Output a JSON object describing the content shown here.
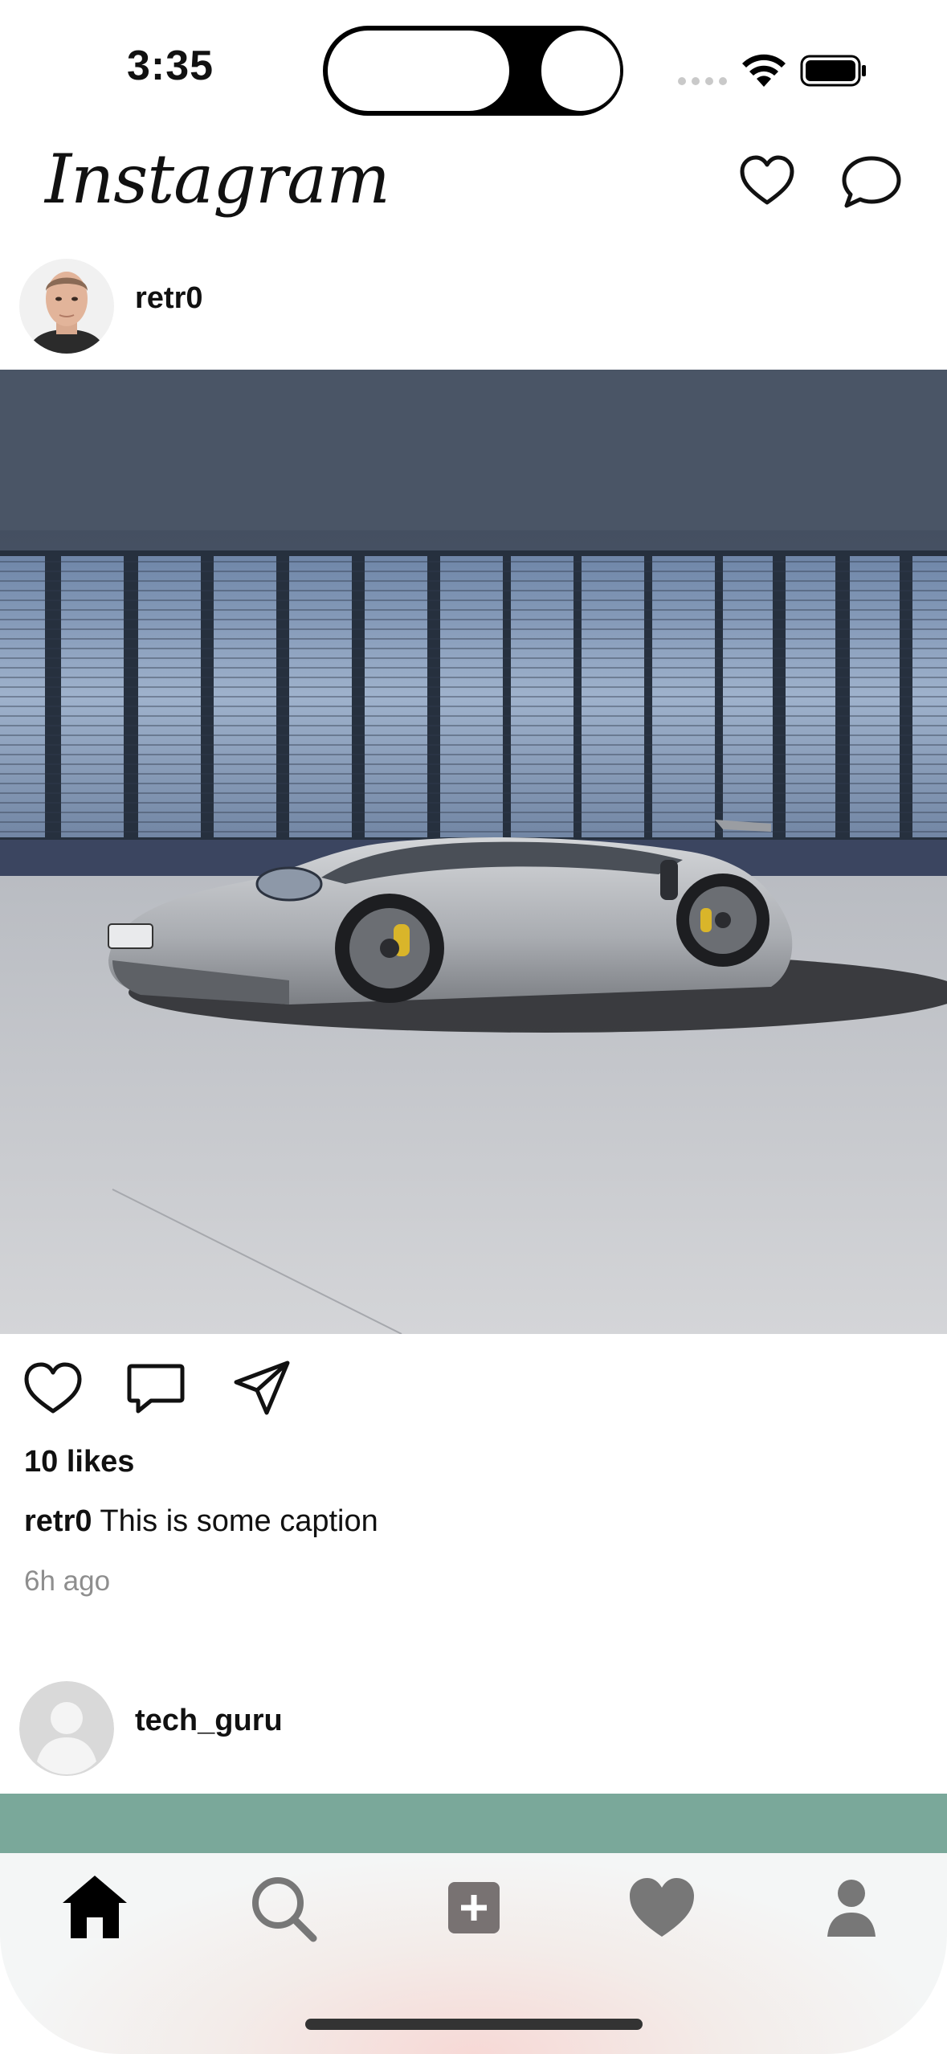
{
  "status_bar": {
    "time": "3:35"
  },
  "header": {
    "logo": "Instagram",
    "icons": [
      "heart-icon",
      "messenger-icon"
    ]
  },
  "posts": [
    {
      "username": "retr0",
      "likes": "10 likes",
      "caption_user": "retr0",
      "caption_text": "This is some caption",
      "time_ago": "6h ago"
    },
    {
      "username": "tech_guru"
    }
  ],
  "tab_bar": {
    "items": [
      "home-icon",
      "search-icon",
      "add-post-icon",
      "activity-heart-icon",
      "profile-icon"
    ],
    "active": "home-icon"
  }
}
